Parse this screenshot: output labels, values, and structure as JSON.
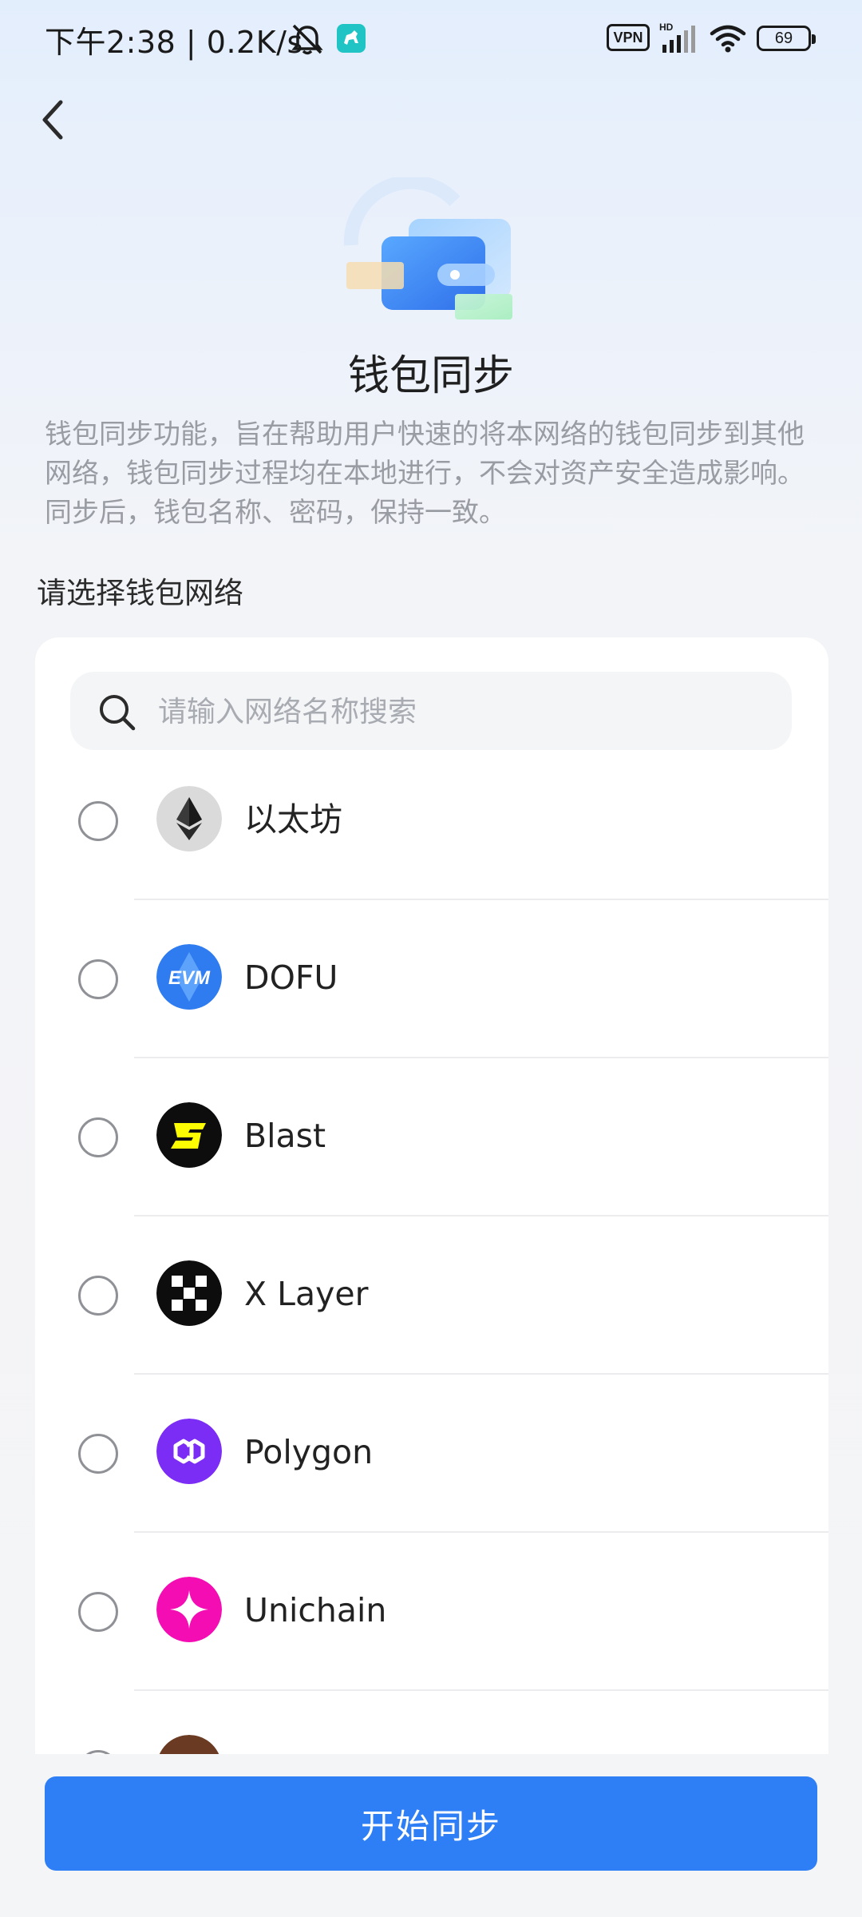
{
  "status_bar": {
    "time_speed": "下午2:38 | 0.2K/s",
    "vpn_label": "VPN",
    "battery_level": "69",
    "icons": [
      "bell-muted-icon",
      "app-icon",
      "vpn-icon",
      "hd-signal-icon",
      "wifi-icon",
      "battery-icon"
    ]
  },
  "header": {
    "back_icon": "chevron-left-icon"
  },
  "hero": {
    "image": "wallet-sync-illustration",
    "title": "钱包同步",
    "description": "钱包同步功能，旨在帮助用户快速的将本网络的钱包同步到其他网络，钱包同步过程均在本地进行，不会对资产安全造成影响。同步后，钱包名称、密码，保持一致。"
  },
  "network_select": {
    "label": "请选择钱包网络",
    "search": {
      "placeholder": "请输入网络名称搜索",
      "value": ""
    },
    "items": [
      {
        "name": "以太坊",
        "icon": "ethereum-icon",
        "selected": false
      },
      {
        "name": "DOFU",
        "icon": "evm-icon",
        "selected": false
      },
      {
        "name": "Blast",
        "icon": "blast-icon",
        "selected": false
      },
      {
        "name": "X Layer",
        "icon": "x-layer-icon",
        "selected": false
      },
      {
        "name": "Polygon",
        "icon": "polygon-icon",
        "selected": false
      },
      {
        "name": "Unichain",
        "icon": "unichain-icon",
        "selected": false
      }
    ]
  },
  "footer": {
    "start_button_label": "开始同步"
  },
  "colors": {
    "primary": "#2e7ff6",
    "background": "#f4f5f7",
    "card": "#ffffff",
    "muted_text": "#9a9ca3"
  }
}
